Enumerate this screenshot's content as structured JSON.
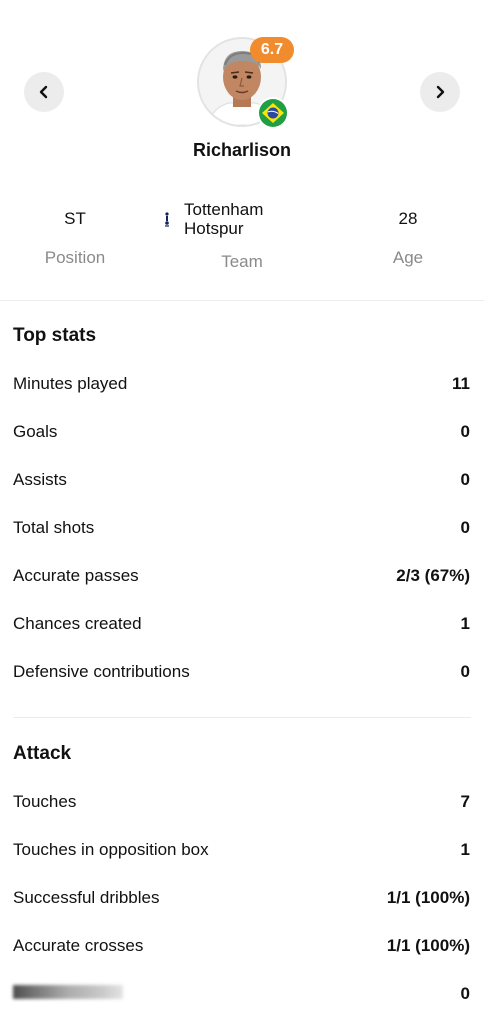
{
  "header": {
    "player": {
      "name": "Richarlison",
      "rating": "6.7",
      "flag_icon": "brazil-flag-icon",
      "rating_color": "#f08c2e"
    },
    "info": {
      "position": {
        "value": "ST",
        "label": "Position"
      },
      "team": {
        "value_line1": "Tottenham",
        "value_line2": "Hotspur",
        "label": "Team",
        "logo_icon": "tottenham-crest-icon"
      },
      "age": {
        "value": "28",
        "label": "Age"
      }
    },
    "nav": {
      "prev_icon": "chevron-left-icon",
      "next_icon": "chevron-right-icon"
    }
  },
  "top_stats": {
    "title": "Top stats",
    "rows": [
      {
        "label": "Minutes played",
        "value": "11"
      },
      {
        "label": "Goals",
        "value": "0"
      },
      {
        "label": "Assists",
        "value": "0"
      },
      {
        "label": "Total shots",
        "value": "0"
      },
      {
        "label": "Accurate passes",
        "value": "2/3 (67%)"
      },
      {
        "label": "Chances created",
        "value": "1"
      },
      {
        "label": "Defensive contributions",
        "value": "0"
      }
    ]
  },
  "attack": {
    "title": "Attack",
    "rows": [
      {
        "label": "Touches",
        "value": "7"
      },
      {
        "label": "Touches in opposition box",
        "value": "1"
      },
      {
        "label": "Successful dribbles",
        "value": "1/1 (100%)"
      },
      {
        "label": "Accurate crosses",
        "value": "1/1 (100%)"
      },
      {
        "label": "",
        "value": "0"
      }
    ]
  }
}
